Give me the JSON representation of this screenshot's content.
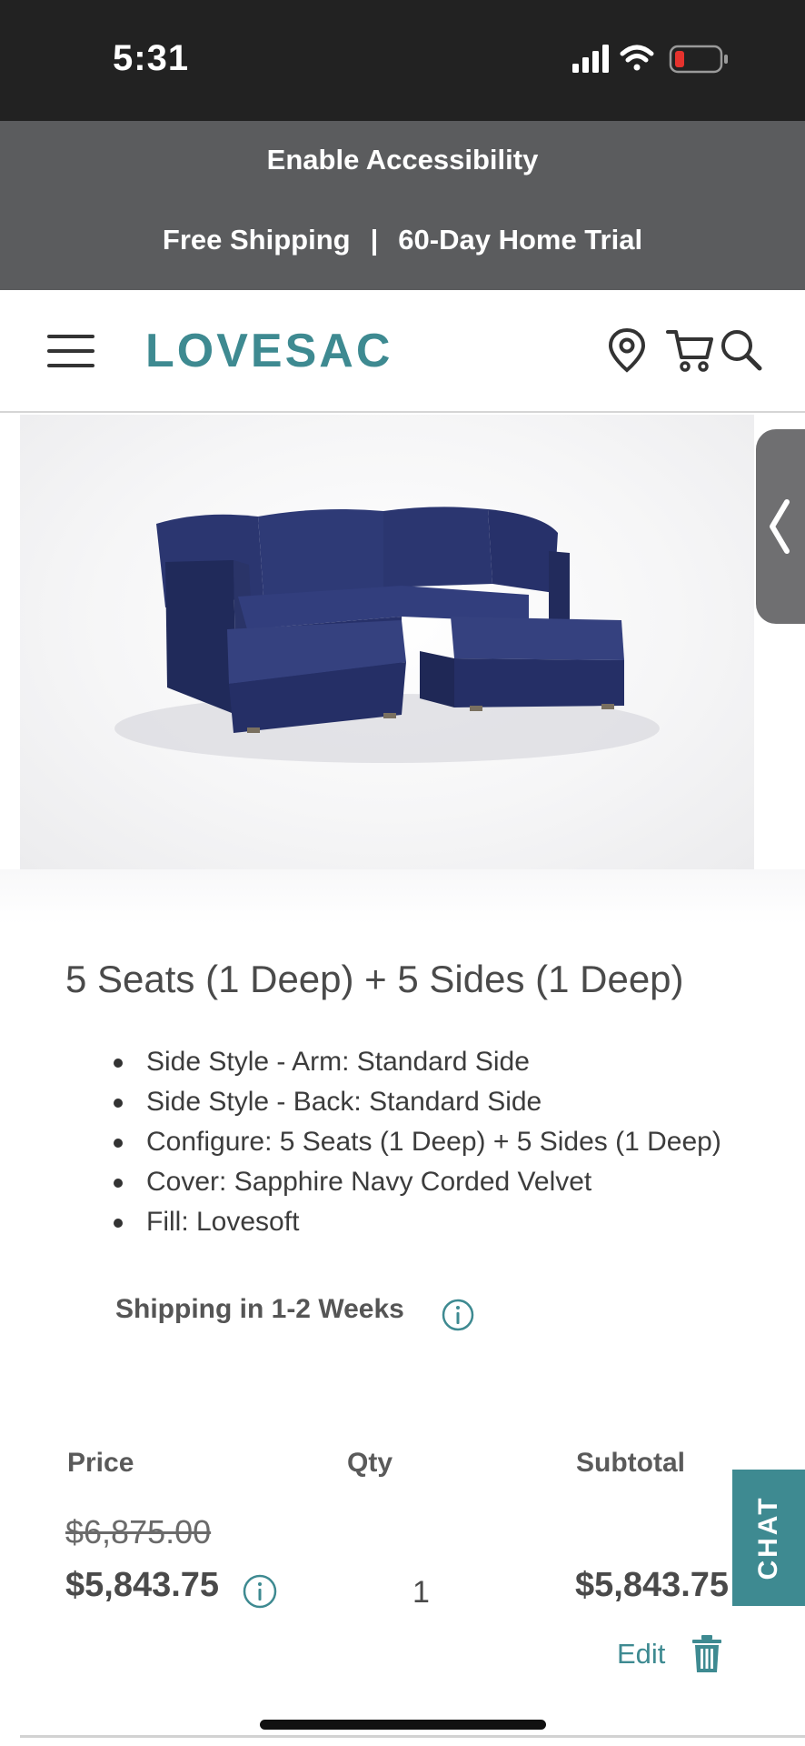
{
  "status_bar": {
    "time": "5:31",
    "icons": [
      "signal-icon",
      "wifi-icon",
      "battery-low-icon"
    ],
    "battery_color": "#e5322d"
  },
  "promo": {
    "accessibility_label": "Enable Accessibility",
    "shipping_text": "Free Shipping",
    "separator": "|",
    "trial_text": "60-Day Home Trial"
  },
  "header": {
    "logo": "LOVESAC",
    "icons": [
      "hamburger-menu-icon",
      "location-pin-icon",
      "cart-icon",
      "search-icon"
    ]
  },
  "product": {
    "title": "5 Seats (1 Deep) + 5 Sides (1 Deep)",
    "specs": [
      "Side Style - Arm: Standard Side",
      "Side Style - Back: Standard Side",
      "Configure: 5 Seats (1 Deep) + 5 Sides (1 Deep)",
      "Cover: Sapphire Navy Corded Velvet",
      "Fill: Lovesoft"
    ],
    "shipping": "Shipping in 1-2 Weeks"
  },
  "pricing": {
    "price_header": "Price",
    "qty_header": "Qty",
    "subtotal_header": "Subtotal",
    "original_price": "$6,875.00",
    "sale_price": "$5,843.75",
    "quantity": "1",
    "subtotal": "$5,843.75",
    "edit_label": "Edit"
  },
  "chat": {
    "label": "CHAT"
  },
  "colors": {
    "brand_teal": "#3e8a91",
    "promo_bg": "#5b5c5e",
    "status_bg": "#222222",
    "sofa_navy": "#27336b"
  }
}
